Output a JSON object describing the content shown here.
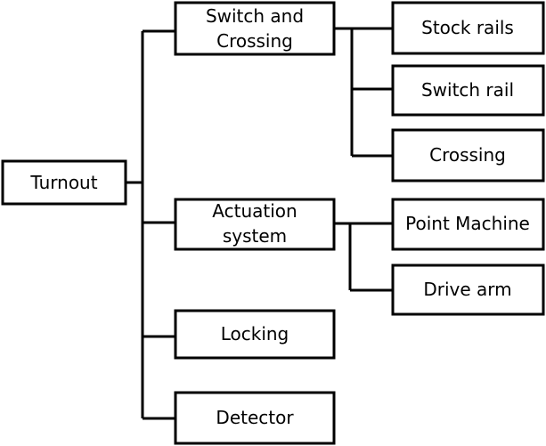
{
  "root": {
    "label": "Turnout"
  },
  "level1": [
    {
      "label_lines": [
        "Switch and",
        "Crossing"
      ]
    },
    {
      "label_lines": [
        "Actuation",
        "system"
      ]
    },
    {
      "label_lines": [
        "Locking"
      ]
    },
    {
      "label_lines": [
        "Detector"
      ]
    }
  ],
  "switch_children": [
    {
      "label": "Stock rails"
    },
    {
      "label": "Switch rail"
    },
    {
      "label": "Crossing"
    }
  ],
  "actuation_children": [
    {
      "label": "Point Machine"
    },
    {
      "label": "Drive arm"
    }
  ]
}
